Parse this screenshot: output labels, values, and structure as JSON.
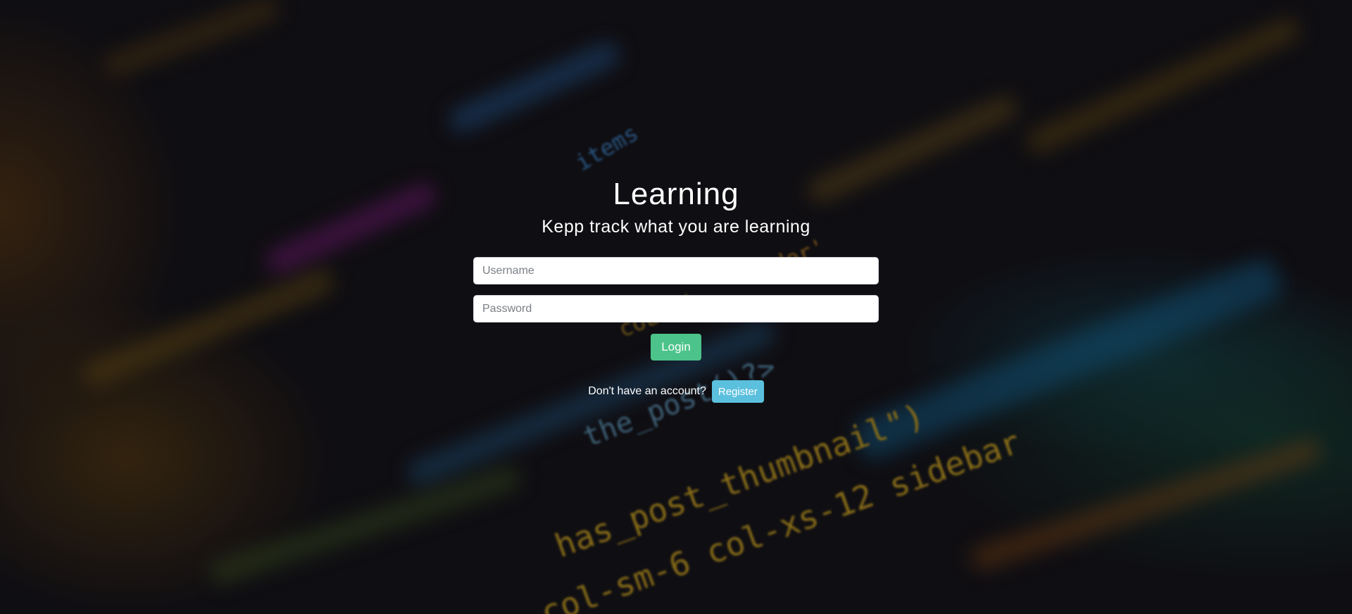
{
  "app": {
    "title": "Learning",
    "subtitle": "Kepp track what you are learning"
  },
  "form": {
    "username": {
      "value": "",
      "placeholder": "Username"
    },
    "password": {
      "value": "",
      "placeholder": "Password"
    },
    "login_label": "Login"
  },
  "register": {
    "prompt": "Don't have an account?",
    "button_label": "Register"
  },
  "background": {
    "code_snippets": [
      "has_post_thumbnail\")",
      "col-sm-6 col-xs-12 sidebar",
      "the_post()?>",
      "'order'",
      "count'",
      "items"
    ]
  },
  "colors": {
    "login_button": "#4cc38a",
    "register_button": "#5bc0de",
    "background": "#131116"
  }
}
